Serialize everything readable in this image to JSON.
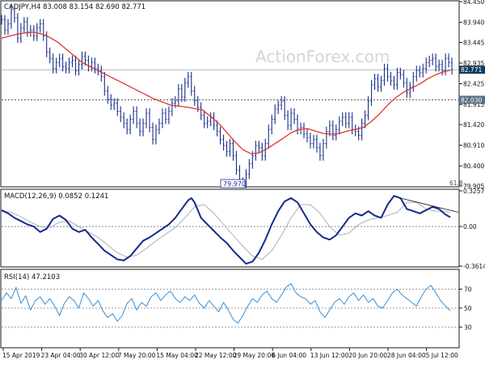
{
  "chart_data": [
    {
      "type": "line",
      "panel": "price",
      "title": "CADJPY,H4  83.008 83.154 82.690 82.771",
      "watermark": "ActionForex.com",
      "ylim": [
        79.905,
        84.45
      ],
      "y_ticks": [
        79.905,
        80.4,
        80.91,
        81.42,
        81.915,
        82.425,
        82.935,
        83.445,
        83.94,
        84.45
      ],
      "x_ticks": [
        "15 Apr 2019",
        "23 Apr 04:00",
        "30 Apr 12:00",
        "7 May 20:00",
        "15 May 04:00",
        "22 May 12:00",
        "29 May 20:00",
        "6 Jun 04:00",
        "13 Jun 12:00",
        "20 Jun 20:00",
        "28 Jun 04:00",
        "5 Jul 12:00"
      ],
      "current_price": 82.771,
      "support_level": 82.03,
      "low_label": "79.970",
      "fib_label": "61.8",
      "colors": {
        "price": "#1a2f8a",
        "ma": "#e0342c",
        "current_tag": "#123a5a",
        "level_tag": "#5a6f80"
      },
      "series": [
        {
          "role": "price",
          "x": [
            0,
            4,
            8,
            12,
            16,
            20,
            24,
            28,
            32,
            36,
            40,
            44,
            48,
            52,
            56,
            60,
            64,
            68,
            72,
            76,
            80,
            84,
            88,
            92,
            96,
            100,
            104,
            108,
            112,
            116,
            120,
            124,
            128,
            132,
            136,
            140,
            144,
            148,
            152,
            156,
            160,
            164,
            168,
            172,
            176,
            180,
            184,
            188,
            192,
            196,
            200,
            204,
            208,
            212,
            216,
            220,
            224,
            228,
            232,
            236,
            240,
            244,
            248,
            252,
            256,
            260,
            264,
            268,
            272,
            276,
            280,
            284,
            288,
            292,
            296,
            300,
            304,
            308,
            312,
            316,
            320,
            324,
            328,
            332,
            336,
            340,
            344,
            348,
            352,
            356,
            360,
            364,
            368,
            372,
            376,
            380,
            384,
            388,
            392,
            396,
            400,
            404,
            408,
            412,
            416,
            420,
            424,
            428,
            432,
            436,
            440,
            444,
            448,
            452,
            456,
            460,
            464,
            468,
            472,
            476,
            480,
            484,
            488,
            492,
            496,
            500,
            504,
            508,
            512,
            516,
            520,
            524,
            528,
            532,
            536,
            540,
            544,
            548,
            552,
            556,
            560
          ],
          "values": [
            84.0,
            83.75,
            83.9,
            84.25,
            84.05,
            83.55,
            83.8,
            83.95,
            83.7,
            83.75,
            83.6,
            83.8,
            83.9,
            83.6,
            83.2,
            83.05,
            82.8,
            82.95,
            83.05,
            82.85,
            82.8,
            82.95,
            83.0,
            82.75,
            82.9,
            83.1,
            83.0,
            82.85,
            82.95,
            82.8,
            82.75,
            82.6,
            82.25,
            82.05,
            81.9,
            81.95,
            81.75,
            81.6,
            81.45,
            81.3,
            81.55,
            81.75,
            81.45,
            81.25,
            81.45,
            81.7,
            81.35,
            81.05,
            81.3,
            81.45,
            81.7,
            81.55,
            81.75,
            81.95,
            82.0,
            82.3,
            82.1,
            82.45,
            82.6,
            82.25,
            82.0,
            81.85,
            81.65,
            81.45,
            81.5,
            81.6,
            81.4,
            81.25,
            81.05,
            80.9,
            80.75,
            80.95,
            80.65,
            80.3,
            80.0,
            79.97,
            80.2,
            80.45,
            80.65,
            80.9,
            80.85,
            80.65,
            80.95,
            81.3,
            81.55,
            81.8,
            81.9,
            82.0,
            81.65,
            81.4,
            81.7,
            81.55,
            81.3,
            81.35,
            81.2,
            81.1,
            80.95,
            81.05,
            80.85,
            80.65,
            80.95,
            81.25,
            81.4,
            81.15,
            81.3,
            81.5,
            81.6,
            81.45,
            81.6,
            81.3,
            81.25,
            81.15,
            81.45,
            81.65,
            82.0,
            82.4,
            82.55,
            82.35,
            82.5,
            82.8,
            82.6,
            82.5,
            82.4,
            82.7,
            82.65,
            82.45,
            82.2,
            82.35,
            82.6,
            82.75,
            82.7,
            82.8,
            82.95,
            83.0,
            83.05,
            82.85,
            82.9,
            82.75,
            83.05,
            82.95,
            82.77
          ]
        },
        {
          "role": "ma",
          "x": [
            0,
            10,
            20,
            30,
            40,
            55,
            70,
            85,
            100,
            115,
            130,
            150,
            170,
            190,
            210,
            230,
            250,
            270,
            290,
            300,
            310,
            320,
            330,
            340,
            350,
            360,
            370,
            380,
            390,
            400,
            410,
            420,
            430,
            440,
            450,
            460,
            470,
            480,
            490,
            500,
            510,
            520,
            530,
            540,
            550,
            558
          ],
          "values": [
            83.55,
            83.6,
            83.65,
            83.68,
            83.7,
            83.62,
            83.45,
            83.2,
            82.95,
            82.8,
            82.65,
            82.45,
            82.25,
            82.05,
            81.9,
            81.85,
            81.78,
            81.45,
            81.0,
            80.8,
            80.7,
            80.72,
            80.82,
            80.95,
            81.08,
            81.22,
            81.3,
            81.32,
            81.26,
            81.2,
            81.18,
            81.2,
            81.26,
            81.3,
            81.35,
            81.5,
            81.68,
            81.9,
            82.08,
            82.22,
            82.32,
            82.42,
            82.55,
            82.65,
            82.72,
            82.76
          ]
        }
      ]
    },
    {
      "type": "line",
      "panel": "macd",
      "title": "MACD(12,26,9) 0.0852 0.1241",
      "ylim": [
        -0.3614,
        0.3257
      ],
      "y_ticks": [
        0.3257,
        0.0,
        -0.3614
      ],
      "y_tick_labels": [
        "0.3257",
        "0.00",
        "-0.3614"
      ],
      "colors": {
        "macd": "#152a8c",
        "signal": "#aab0b8",
        "trendline": "#1a1a1a"
      },
      "series": [
        {
          "role": "macd",
          "x": [
            0,
            8,
            16,
            24,
            32,
            40,
            48,
            56,
            64,
            72,
            80,
            88,
            96,
            104,
            112,
            120,
            128,
            136,
            144,
            152,
            160,
            168,
            176,
            184,
            192,
            200,
            208,
            216,
            224,
            232,
            236,
            240,
            244,
            248,
            256,
            264,
            272,
            280,
            288,
            296,
            304,
            312,
            320,
            328,
            336,
            344,
            352,
            360,
            368,
            376,
            384,
            392,
            400,
            408,
            416,
            424,
            432,
            440,
            448,
            456,
            464,
            472,
            480,
            488,
            496,
            504,
            512,
            520,
            528,
            536,
            544,
            552,
            558
          ],
          "values": [
            0.15,
            0.12,
            0.08,
            0.05,
            0.02,
            0.0,
            -0.05,
            -0.02,
            0.07,
            0.1,
            0.06,
            -0.02,
            -0.05,
            -0.03,
            -0.1,
            -0.16,
            -0.22,
            -0.26,
            -0.3,
            -0.31,
            -0.27,
            -0.2,
            -0.13,
            -0.1,
            -0.06,
            -0.02,
            0.02,
            0.08,
            0.16,
            0.24,
            0.26,
            0.22,
            0.15,
            0.08,
            0.02,
            -0.04,
            -0.1,
            -0.15,
            -0.22,
            -0.28,
            -0.34,
            -0.32,
            -0.24,
            -0.12,
            0.02,
            0.14,
            0.23,
            0.26,
            0.22,
            0.12,
            0.02,
            -0.05,
            -0.1,
            -0.12,
            -0.08,
            0.0,
            0.08,
            0.12,
            0.1,
            0.14,
            0.1,
            0.08,
            0.2,
            0.28,
            0.26,
            0.16,
            0.14,
            0.12,
            0.15,
            0.18,
            0.16,
            0.11,
            0.0852
          ]
        },
        {
          "role": "signal",
          "x": [
            0,
            12,
            24,
            36,
            48,
            60,
            72,
            84,
            96,
            108,
            120,
            132,
            144,
            156,
            168,
            180,
            192,
            204,
            216,
            228,
            240,
            252,
            264,
            276,
            288,
            300,
            312,
            324,
            336,
            348,
            360,
            372,
            384,
            396,
            408,
            420,
            432,
            444,
            456,
            468,
            480,
            492,
            504,
            516,
            528,
            540,
            552,
            558
          ],
          "values": [
            0.14,
            0.13,
            0.09,
            0.04,
            0.0,
            -0.01,
            0.04,
            0.05,
            0.0,
            -0.05,
            -0.1,
            -0.17,
            -0.24,
            -0.28,
            -0.26,
            -0.2,
            -0.13,
            -0.07,
            -0.01,
            0.08,
            0.18,
            0.2,
            0.12,
            0.02,
            -0.08,
            -0.18,
            -0.27,
            -0.3,
            -0.22,
            -0.08,
            0.08,
            0.2,
            0.2,
            0.12,
            0.0,
            -0.08,
            -0.06,
            0.02,
            0.06,
            0.08,
            0.1,
            0.13,
            0.22,
            0.22,
            0.16,
            0.14,
            0.14,
            0.1241
          ]
        },
        {
          "role": "trendline",
          "x": [
            490,
            568
          ],
          "values": [
            0.27,
            0.13
          ]
        }
      ]
    },
    {
      "type": "line",
      "panel": "rsi",
      "title": "RSI(14) 47.2103",
      "ylim": [
        0,
        100
      ],
      "y_ticks": [
        70,
        50,
        30
      ],
      "y_tick_labels": [
        "70",
        "50",
        "30"
      ],
      "colors": {
        "rsi": "#3a8fd0",
        "levels": "#8a9099"
      },
      "series": [
        {
          "role": "rsi",
          "x": [
            0,
            6,
            12,
            18,
            24,
            30,
            36,
            42,
            48,
            54,
            60,
            66,
            72,
            78,
            84,
            90,
            96,
            102,
            108,
            114,
            120,
            126,
            132,
            138,
            144,
            150,
            156,
            162,
            168,
            174,
            180,
            186,
            192,
            198,
            204,
            210,
            216,
            222,
            228,
            234,
            240,
            246,
            252,
            258,
            264,
            270,
            276,
            282,
            288,
            294,
            300,
            306,
            312,
            318,
            324,
            330,
            336,
            342,
            348,
            354,
            360,
            366,
            372,
            378,
            384,
            390,
            396,
            402,
            408,
            414,
            420,
            426,
            432,
            438,
            444,
            450,
            456,
            462,
            468,
            474,
            480,
            486,
            492,
            498,
            504,
            510,
            516,
            522,
            528,
            534,
            540,
            546,
            552,
            558
          ],
          "values": [
            58,
            66,
            60,
            72,
            55,
            63,
            48,
            58,
            62,
            54,
            60,
            52,
            42,
            55,
            62,
            58,
            50,
            66,
            60,
            52,
            58,
            47,
            40,
            44,
            36,
            42,
            55,
            60,
            48,
            56,
            52,
            62,
            66,
            58,
            64,
            68,
            60,
            56,
            62,
            58,
            64,
            55,
            50,
            58,
            52,
            46,
            56,
            48,
            38,
            34,
            42,
            52,
            60,
            56,
            64,
            68,
            60,
            56,
            64,
            72,
            76,
            66,
            62,
            60,
            54,
            58,
            46,
            40,
            48,
            56,
            60,
            54,
            62,
            66,
            58,
            64,
            56,
            60,
            52,
            50,
            58,
            66,
            70,
            64,
            60,
            56,
            52,
            62,
            70,
            74,
            66,
            58,
            52,
            47.21
          ]
        }
      ]
    }
  ]
}
